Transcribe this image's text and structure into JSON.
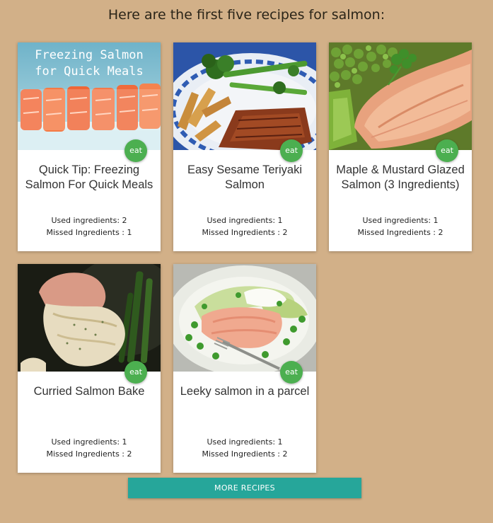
{
  "heading": "Here are the first five recipes for salmon:",
  "eat_label": "eat",
  "recipes": [
    {
      "title_line1": "Quick Tip: Freezing",
      "title_line2": "Salmon For Quick Meals",
      "used": "Used ingredients: 2",
      "missed": "Missed Ingredients : 1",
      "image_text_line1": "Freezing Salmon",
      "image_text_line2": "for Quick Meals"
    },
    {
      "title_line1": "Easy Sesame Teriyaki",
      "title_line2": "Salmon",
      "used": "Used ingredients: 1",
      "missed": "Missed Ingredients : 2"
    },
    {
      "title_line1": "Maple & Mustard Glazed",
      "title_line2": "Salmon (3 Ingredients)",
      "used": "Used ingredients: 1",
      "missed": "Missed Ingredients : 2"
    },
    {
      "title_line1": "Curried Salmon Bake",
      "title_line2": "",
      "used": "Used ingredients: 1",
      "missed": "Missed Ingredients : 2"
    },
    {
      "title_line1": "Leeky salmon in a parcel",
      "title_line2": "",
      "used": "Used ingredients: 1",
      "missed": "Missed Ingredients : 2"
    }
  ],
  "more_button": "MORE RECIPES",
  "colors": {
    "background": "#d2b088",
    "eat_badge": "#4caf50",
    "more_button": "#26a69a"
  }
}
